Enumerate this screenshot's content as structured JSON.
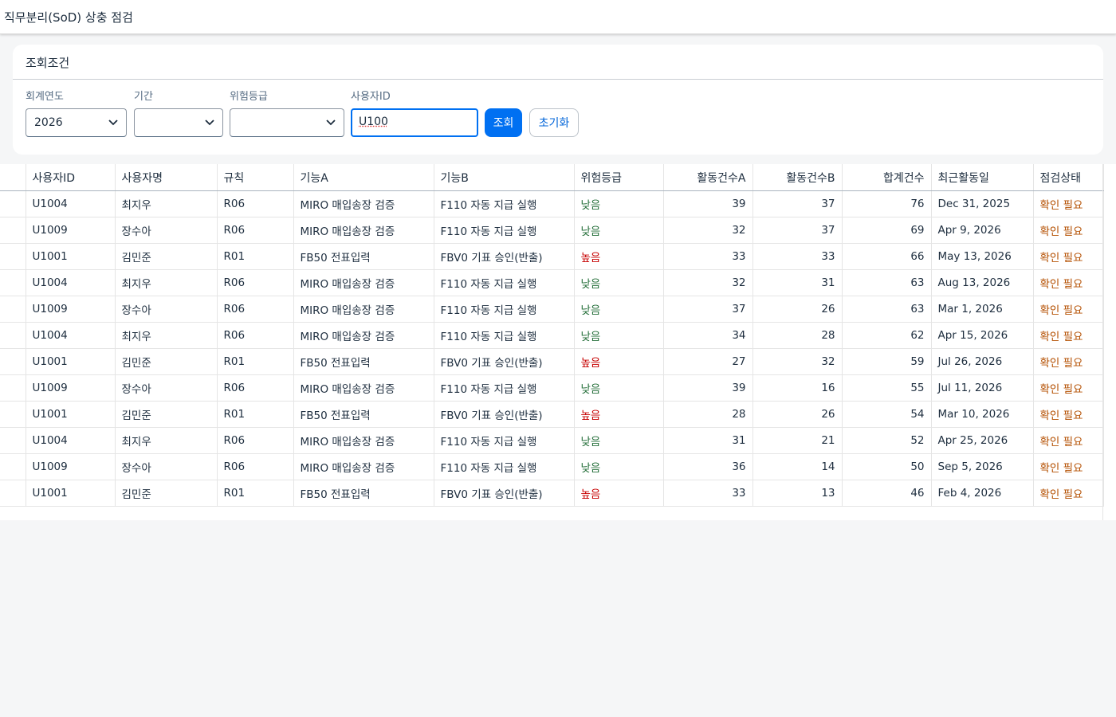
{
  "header": {
    "title": "직무분리(SoD) 상충 점검"
  },
  "filter": {
    "panel_title": "조회조건",
    "fiscal_year": {
      "label": "회계연도",
      "value": "2026"
    },
    "period": {
      "label": "기간",
      "value": ""
    },
    "risk_level": {
      "label": "위험등급",
      "value": ""
    },
    "user_id": {
      "label": "사용자ID",
      "value": "U100"
    },
    "search_button": "조회",
    "reset_button": "초기화"
  },
  "table": {
    "columns": [
      "사용자ID",
      "사용자명",
      "규칙",
      "기능A",
      "기능B",
      "위험등급",
      "활동건수A",
      "활동건수B",
      "합계건수",
      "최근활동일",
      "점검상태"
    ],
    "rows": [
      [
        "U1004",
        "최지우",
        "R06",
        "MIRO 매입송장 검증",
        "F110 자동 지급 실행",
        "낮음",
        "39",
        "37",
        "76",
        "Dec 31, 2025",
        "확인 필요"
      ],
      [
        "U1009",
        "장수아",
        "R06",
        "MIRO 매입송장 검증",
        "F110 자동 지급 실행",
        "낮음",
        "32",
        "37",
        "69",
        "Apr 9, 2026",
        "확인 필요"
      ],
      [
        "U1001",
        "김민준",
        "R01",
        "FB50 전표입력",
        "FBV0 기표 승인(반출)",
        "높음",
        "33",
        "33",
        "66",
        "May 13, 2026",
        "확인 필요"
      ],
      [
        "U1004",
        "최지우",
        "R06",
        "MIRO 매입송장 검증",
        "F110 자동 지급 실행",
        "낮음",
        "32",
        "31",
        "63",
        "Aug 13, 2026",
        "확인 필요"
      ],
      [
        "U1009",
        "장수아",
        "R06",
        "MIRO 매입송장 검증",
        "F110 자동 지급 실행",
        "낮음",
        "37",
        "26",
        "63",
        "Mar 1, 2026",
        "확인 필요"
      ],
      [
        "U1004",
        "최지우",
        "R06",
        "MIRO 매입송장 검증",
        "F110 자동 지급 실행",
        "낮음",
        "34",
        "28",
        "62",
        "Apr 15, 2026",
        "확인 필요"
      ],
      [
        "U1001",
        "김민준",
        "R01",
        "FB50 전표입력",
        "FBV0 기표 승인(반출)",
        "높음",
        "27",
        "32",
        "59",
        "Jul 26, 2026",
        "확인 필요"
      ],
      [
        "U1009",
        "장수아",
        "R06",
        "MIRO 매입송장 검증",
        "F110 자동 지급 실행",
        "낮음",
        "39",
        "16",
        "55",
        "Jul 11, 2026",
        "확인 필요"
      ],
      [
        "U1001",
        "김민준",
        "R01",
        "FB50 전표입력",
        "FBV0 기표 승인(반출)",
        "높음",
        "28",
        "26",
        "54",
        "Mar 10, 2026",
        "확인 필요"
      ],
      [
        "U1004",
        "최지우",
        "R06",
        "MIRO 매입송장 검증",
        "F110 자동 지급 실행",
        "낮음",
        "31",
        "21",
        "52",
        "Apr 25, 2026",
        "확인 필요"
      ],
      [
        "U1009",
        "장수아",
        "R06",
        "MIRO 매입송장 검증",
        "F110 자동 지급 실행",
        "낮음",
        "36",
        "14",
        "50",
        "Sep 5, 2026",
        "확인 필요"
      ],
      [
        "U1001",
        "김민준",
        "R01",
        "FB50 전표입력",
        "FBV0 기표 승인(반출)",
        "높음",
        "33",
        "13",
        "46",
        "Feb 4, 2026",
        "확인 필요"
      ]
    ]
  },
  "colors": {
    "accent": "#0070f2",
    "risk_low": "#256f3a",
    "risk_high": "#c60000",
    "status_warning": "#b44f00"
  },
  "icons": {
    "select_arrow": "chevron-down-icon"
  }
}
